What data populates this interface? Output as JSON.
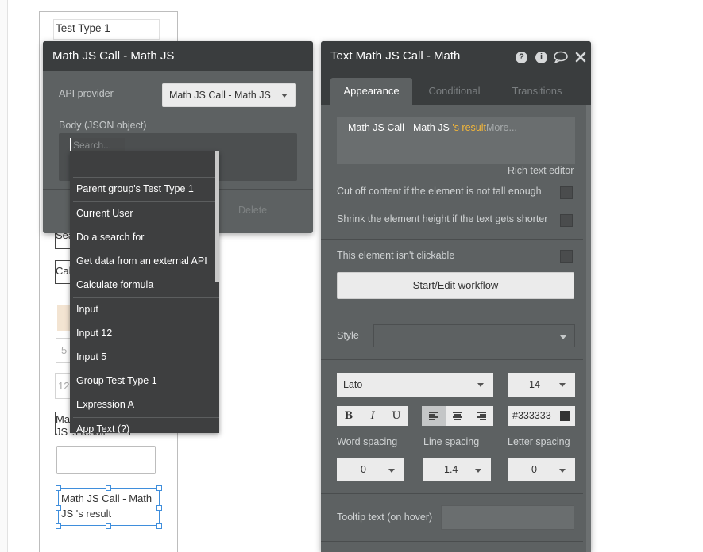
{
  "canvas": {
    "items": [
      {
        "text": "Test Type 1"
      },
      {
        "text": "Sea"
      },
      {
        "text": "Cal"
      },
      {
        "text": "5"
      },
      {
        "text": "12"
      },
      {
        "text": "Ma"
      },
      {
        "text": "JS 's result"
      }
    ],
    "selected_text": "Math JS Call - Math JS 's result"
  },
  "left_panel": {
    "title": "Math JS Call - Math JS",
    "api_provider_label": "API provider",
    "api_provider_value": "Math JS Call - Math JS",
    "body_label": "Body (JSON object)",
    "delete_label": "Delete"
  },
  "autocomplete": {
    "search_placeholder": "Search...",
    "groups": [
      [
        "Parent group's Test Type 1",
        "Current User",
        "Do a search for",
        "Get data from an external API",
        "Calculate formula"
      ],
      [
        "Input",
        "Input 12",
        "Input 5",
        "Group Test Type 1",
        "Expression A"
      ],
      [
        "App Text (?)"
      ]
    ]
  },
  "right_panel": {
    "title": "Text Math JS Call - Math",
    "icons": [
      "help-icon",
      "info-icon",
      "comment-icon",
      "close-icon"
    ],
    "tabs": [
      "Appearance",
      "Conditional",
      "Transitions"
    ],
    "content": {
      "text": "Math JS Call - Math JS",
      "highlight": "'s result",
      "more": "More..."
    },
    "rich_text_editor": "Rich text editor",
    "options": [
      "Cut off content if the element is not tall enough",
      "Shrink the element height if the text gets shorter",
      "This element isn't clickable"
    ],
    "workflow_button": "Start/Edit workflow",
    "style_label": "Style",
    "font_family": "Lato",
    "font_size": "14",
    "format_buttons": [
      "B",
      "I",
      "U"
    ],
    "color_value": "#333333",
    "color_swatch": "#333333",
    "spacing": {
      "word_label": "Word spacing",
      "word_value": "0",
      "line_label": "Line spacing",
      "line_value": "1.4",
      "letter_label": "Letter spacing",
      "letter_value": "0"
    },
    "tooltip_label": "Tooltip text (on hover)"
  },
  "colors": {
    "panel_bg": "#5d6162",
    "header_bg": "#3a3d3e",
    "dropdown_bg": "#3e3f40",
    "highlight": "#f2b63a",
    "selection": "#3f8edc"
  }
}
